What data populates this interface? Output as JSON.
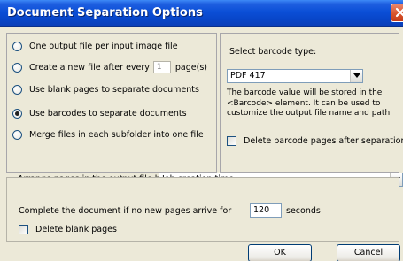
{
  "window": {
    "title": "Document Separation Options"
  },
  "options": [
    {
      "label": "One output file per input image file",
      "checked": false
    },
    {
      "label_prefix": "Create a new file after every",
      "value": "1",
      "label_suffix": "page(s)",
      "checked": false
    },
    {
      "label": "Use blank pages to separate documents",
      "checked": false
    },
    {
      "label": "Use barcodes to separate documents",
      "checked": true
    },
    {
      "label": "Merge files in each subfolder into one file",
      "checked": false
    }
  ],
  "barcode": {
    "label": "Select barcode type:",
    "selected": "PDF 417",
    "description": "The barcode value will be stored in the <Barcode> element. It can be used to customize the output file name and path.",
    "delete_label": "Delete barcode pages after separation"
  },
  "arrange": {
    "label": "Arrange pages in the output file by:",
    "selected": "Job creation time"
  },
  "complete": {
    "label_prefix": "Complete the document if no new pages arrive for",
    "value": "120",
    "label_suffix": "seconds"
  },
  "delete_blank_label": "Delete blank pages",
  "buttons": {
    "ok": "OK",
    "cancel": "Cancel"
  }
}
